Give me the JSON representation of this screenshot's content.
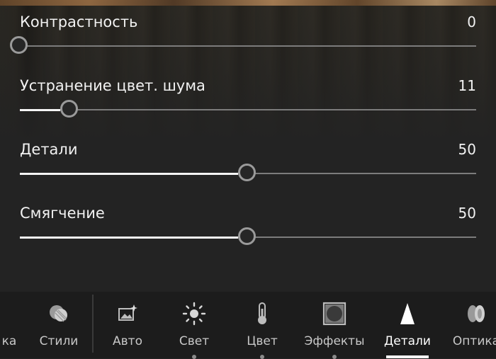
{
  "sliders": [
    {
      "label": "Контрастность",
      "value": "0",
      "level_percent": 0
    },
    {
      "label": "Устранение цвет. шума",
      "value": "11",
      "level_percent": 11
    },
    {
      "label": "Детали",
      "value": "50",
      "level_percent": 50
    },
    {
      "label": "Смягчение",
      "value": "50",
      "level_percent": 50
    }
  ],
  "toolbar": {
    "items": [
      {
        "label": "ка",
        "icon": "partial-tool"
      },
      {
        "label": "Стили",
        "icon": "styles-icon"
      },
      {
        "label": "Авто",
        "icon": "auto-icon"
      },
      {
        "label": "Свет",
        "icon": "light-icon"
      },
      {
        "label": "Цвет",
        "icon": "thermometer-icon"
      },
      {
        "label": "Эффекты",
        "icon": "effects-icon"
      },
      {
        "label": "Детали",
        "icon": "detail-icon",
        "active": true
      },
      {
        "label": "Оптика",
        "icon": "optics-icon"
      }
    ]
  },
  "colors": {
    "background": "#232323",
    "toolbar": "#1c1c1c",
    "accent": "#ffffff",
    "track": "#7c7c7c"
  }
}
